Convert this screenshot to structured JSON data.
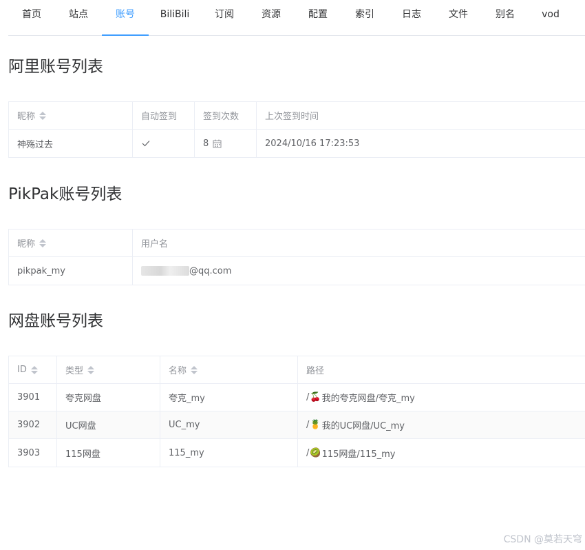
{
  "nav": {
    "tabs": [
      {
        "label": "首页"
      },
      {
        "label": "站点"
      },
      {
        "label": "账号"
      },
      {
        "label": "BiliBili"
      },
      {
        "label": "订阅"
      },
      {
        "label": "资源"
      },
      {
        "label": "配置"
      },
      {
        "label": "索引"
      },
      {
        "label": "日志"
      },
      {
        "label": "文件"
      },
      {
        "label": "别名"
      },
      {
        "label": "vod"
      }
    ],
    "active": "账号"
  },
  "ali": {
    "title": "阿里账号列表",
    "headers": {
      "nickname": "昵称",
      "auto_sign": "自动签到",
      "sign_count": "签到次数",
      "last_sign": "上次签到时间"
    },
    "rows": [
      {
        "nickname": "神殇过去",
        "auto_sign": "✓",
        "sign_count": "8",
        "last_sign": "2024/10/16 17:23:53"
      }
    ]
  },
  "pikpak": {
    "title": "PikPak账号列表",
    "headers": {
      "nickname": "昵称",
      "username": "用户名"
    },
    "rows": [
      {
        "nickname": "pikpak_my",
        "username_suffix": "@qq.com"
      }
    ]
  },
  "pan": {
    "title": "网盘账号列表",
    "headers": {
      "id": "ID",
      "type": "类型",
      "name": "名称",
      "path": "路径"
    },
    "rows": [
      {
        "id": "3901",
        "type": "夸克网盘",
        "name": "夸克_my",
        "path_prefix": "/",
        "path_icon": "🍒",
        "path_rest": "我的夸克网盘/夸克_my"
      },
      {
        "id": "3902",
        "type": "UC网盘",
        "name": "UC_my",
        "path_prefix": "/",
        "path_icon": "🍍",
        "path_rest": "我的UC网盘/UC_my"
      },
      {
        "id": "3903",
        "type": "115网盘",
        "name": "115_my",
        "path_prefix": "/",
        "path_icon": "🥝",
        "path_rest": "115网盘/115_my"
      }
    ]
  },
  "watermark": "CSDN @莫若天穹",
  "colors": {
    "accent": "#409eff",
    "border": "#ebeef5",
    "header_text": "#909399"
  }
}
